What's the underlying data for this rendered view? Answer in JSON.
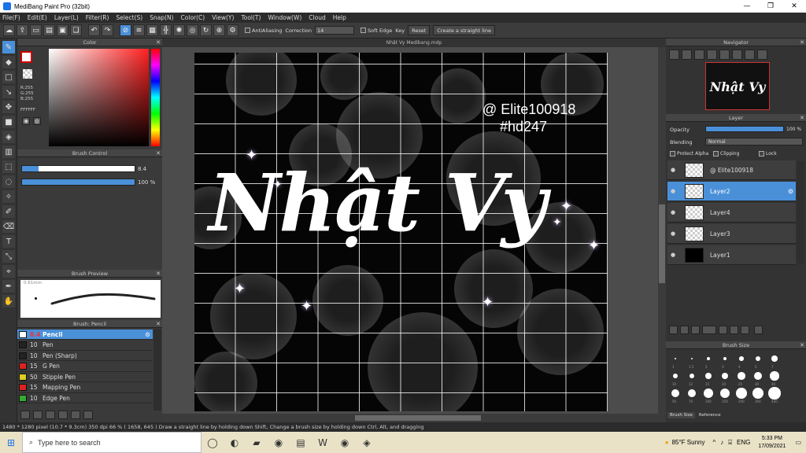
{
  "window": {
    "title": "MediBang Paint Pro (32bit)",
    "controls": [
      "—",
      "❐",
      "✕"
    ]
  },
  "menu": [
    "File(F)",
    "Edit(E)",
    "Layer(L)",
    "Filter(R)",
    "Select(S)",
    "Snap(N)",
    "Color(C)",
    "View(Y)",
    "Tool(T)",
    "Window(W)",
    "Cloud",
    "Help"
  ],
  "toolbar": {
    "antialiasing": "AntiAliasing",
    "correction_label": "Correction",
    "correction_value": "14",
    "soft_edge": "Soft Edge",
    "key": "Key",
    "reset": "Reset",
    "straight_line": "Create a straight line"
  },
  "color_panel": {
    "title": "Color",
    "rgb": "R:255\nG:255\nB:255",
    "hex": "FFFFFF",
    "primary": "#ffffff",
    "accent": "#cc0000"
  },
  "brush_control": {
    "title": "Brush Control",
    "size": "8.4",
    "opacity": "100 %",
    "size_frac": 0.15,
    "opacity_frac": 1.0
  },
  "brush_preview": {
    "title": "Brush Preview",
    "size_label": "0.61mm"
  },
  "brush_list": {
    "title": "Brush: Pencil",
    "items": [
      {
        "num": "8.4",
        "name": "Pencil",
        "color": "#ffffff",
        "selected": true
      },
      {
        "num": "10",
        "name": "Pen",
        "color": "#222222"
      },
      {
        "num": "10",
        "name": "Pen (Sharp)",
        "color": "#222222"
      },
      {
        "num": "15",
        "name": "G Pen",
        "color": "#dd2222"
      },
      {
        "num": "50",
        "name": "Stipple Pen",
        "color": "#ddcc22"
      },
      {
        "num": "15",
        "name": "Mapping Pen",
        "color": "#dd2222"
      },
      {
        "num": "10",
        "name": "Edge Pen",
        "color": "#33aa33"
      }
    ]
  },
  "document": {
    "tab": "Nhật Vy Medibang.mdp"
  },
  "artwork": {
    "handle": "@ Elite100918",
    "tag": "#hd247",
    "name": "Nhật Vy"
  },
  "navigator": {
    "title": "Navigator",
    "thumb_text": "Nhật Vy"
  },
  "layer_panel": {
    "title": "Layer",
    "opacity_label": "Opacity",
    "opacity_value": "100 %",
    "blending_label": "Blending",
    "blending_value": "Normal",
    "protect_alpha": "Protect Alpha",
    "clipping": "Clipping",
    "lock": "Lock",
    "layers": [
      {
        "name": "@ Elite100918",
        "selected": false,
        "thumb": "check"
      },
      {
        "name": "Layer2",
        "selected": true,
        "thumb": "check"
      },
      {
        "name": "Layer4",
        "selected": false,
        "thumb": "check"
      },
      {
        "name": "Layer3",
        "selected": false,
        "thumb": "check"
      },
      {
        "name": "Layer1",
        "selected": false,
        "thumb": "black"
      }
    ]
  },
  "brush_size": {
    "title": "Brush Size",
    "tabs": [
      "Brush Size",
      "Reference"
    ],
    "row1": [
      1,
      1.5,
      2,
      3,
      4,
      5,
      7
    ],
    "row2": [
      10,
      12,
      15,
      20,
      25,
      30,
      40
    ],
    "row3": [
      50,
      70,
      100,
      150,
      200,
      300,
      400
    ]
  },
  "status": {
    "text": "1480 * 1280 pixel   (10.7 * 9.3cm)   350 dpi   66 %   ( 1658, 645 )   Draw a straight line by holding down Shift, Change a brush size by holding down Ctrl, Alt, and dragging"
  },
  "taskbar": {
    "search_placeholder": "Type here to search",
    "weather": "85°F  Sunny",
    "lang": "ENG",
    "time": "5:33 PM",
    "date": "17/09/2021"
  }
}
